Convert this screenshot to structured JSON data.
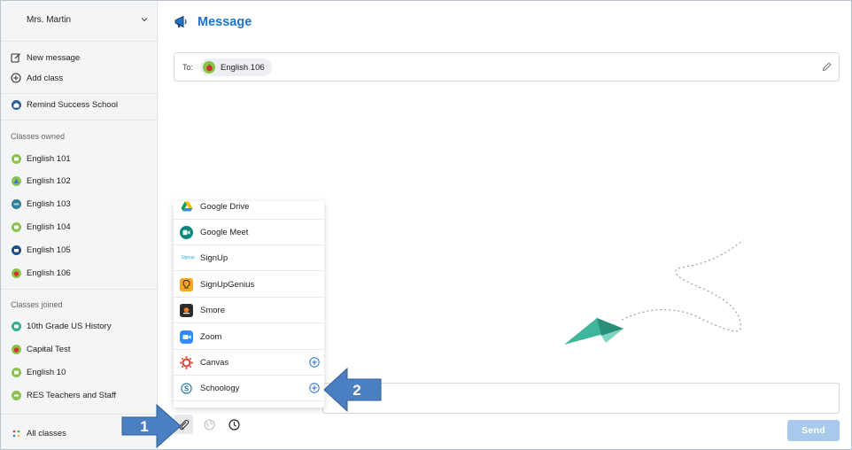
{
  "sidebar": {
    "user_name": "Mrs. Martin",
    "actions": [
      {
        "label": "New message",
        "icon": "compose-icon"
      },
      {
        "label": "Add class",
        "icon": "plus-circle-icon"
      }
    ],
    "school": {
      "label": "Remind Success School",
      "icon": "school-icon"
    },
    "owned_header": "Classes owned",
    "owned": [
      {
        "label": "English 101",
        "color": "#8bc34a"
      },
      {
        "label": "English 102",
        "color": "#8bc34a"
      },
      {
        "label": "English 103",
        "color": "#2e7d9a"
      },
      {
        "label": "English 104",
        "color": "#8bc34a"
      },
      {
        "label": "English 105",
        "color": "#1f4f8a"
      },
      {
        "label": "English 106",
        "color": "#8bc34a"
      }
    ],
    "joined_header": "Classes joined",
    "joined": [
      {
        "label": "10th Grade US History",
        "color": "#2fb38a"
      },
      {
        "label": "Capital Test",
        "color": "#8bc34a"
      },
      {
        "label": "English 10",
        "color": "#8bc34a"
      },
      {
        "label": "RES Teachers and Staff",
        "color": "#8bc34a"
      }
    ],
    "all_classes": "All classes"
  },
  "main": {
    "title": "Message",
    "to_label": "To:",
    "recipient": "English 106",
    "send_label": "Send"
  },
  "dropdown": {
    "items": [
      {
        "label": "Google Drive",
        "icon": "google-drive-icon",
        "has_add": false
      },
      {
        "label": "Google Meet",
        "icon": "google-meet-icon",
        "has_add": false
      },
      {
        "label": "SignUp",
        "icon": "signup-icon",
        "has_add": false
      },
      {
        "label": "SignUpGenius",
        "icon": "signupgenius-icon",
        "has_add": false
      },
      {
        "label": "Smore",
        "icon": "smore-icon",
        "has_add": false
      },
      {
        "label": "Zoom",
        "icon": "zoom-icon",
        "has_add": false
      },
      {
        "label": "Canvas",
        "icon": "canvas-icon",
        "has_add": true
      },
      {
        "label": "Schoology",
        "icon": "schoology-icon",
        "has_add": true
      }
    ]
  },
  "annotations": {
    "arrow1": "1",
    "arrow2": "2"
  },
  "colors": {
    "accent": "#1f73c7",
    "send_disabled": "#a8c9eb",
    "annotation_arrow": "#4a7fc1"
  }
}
